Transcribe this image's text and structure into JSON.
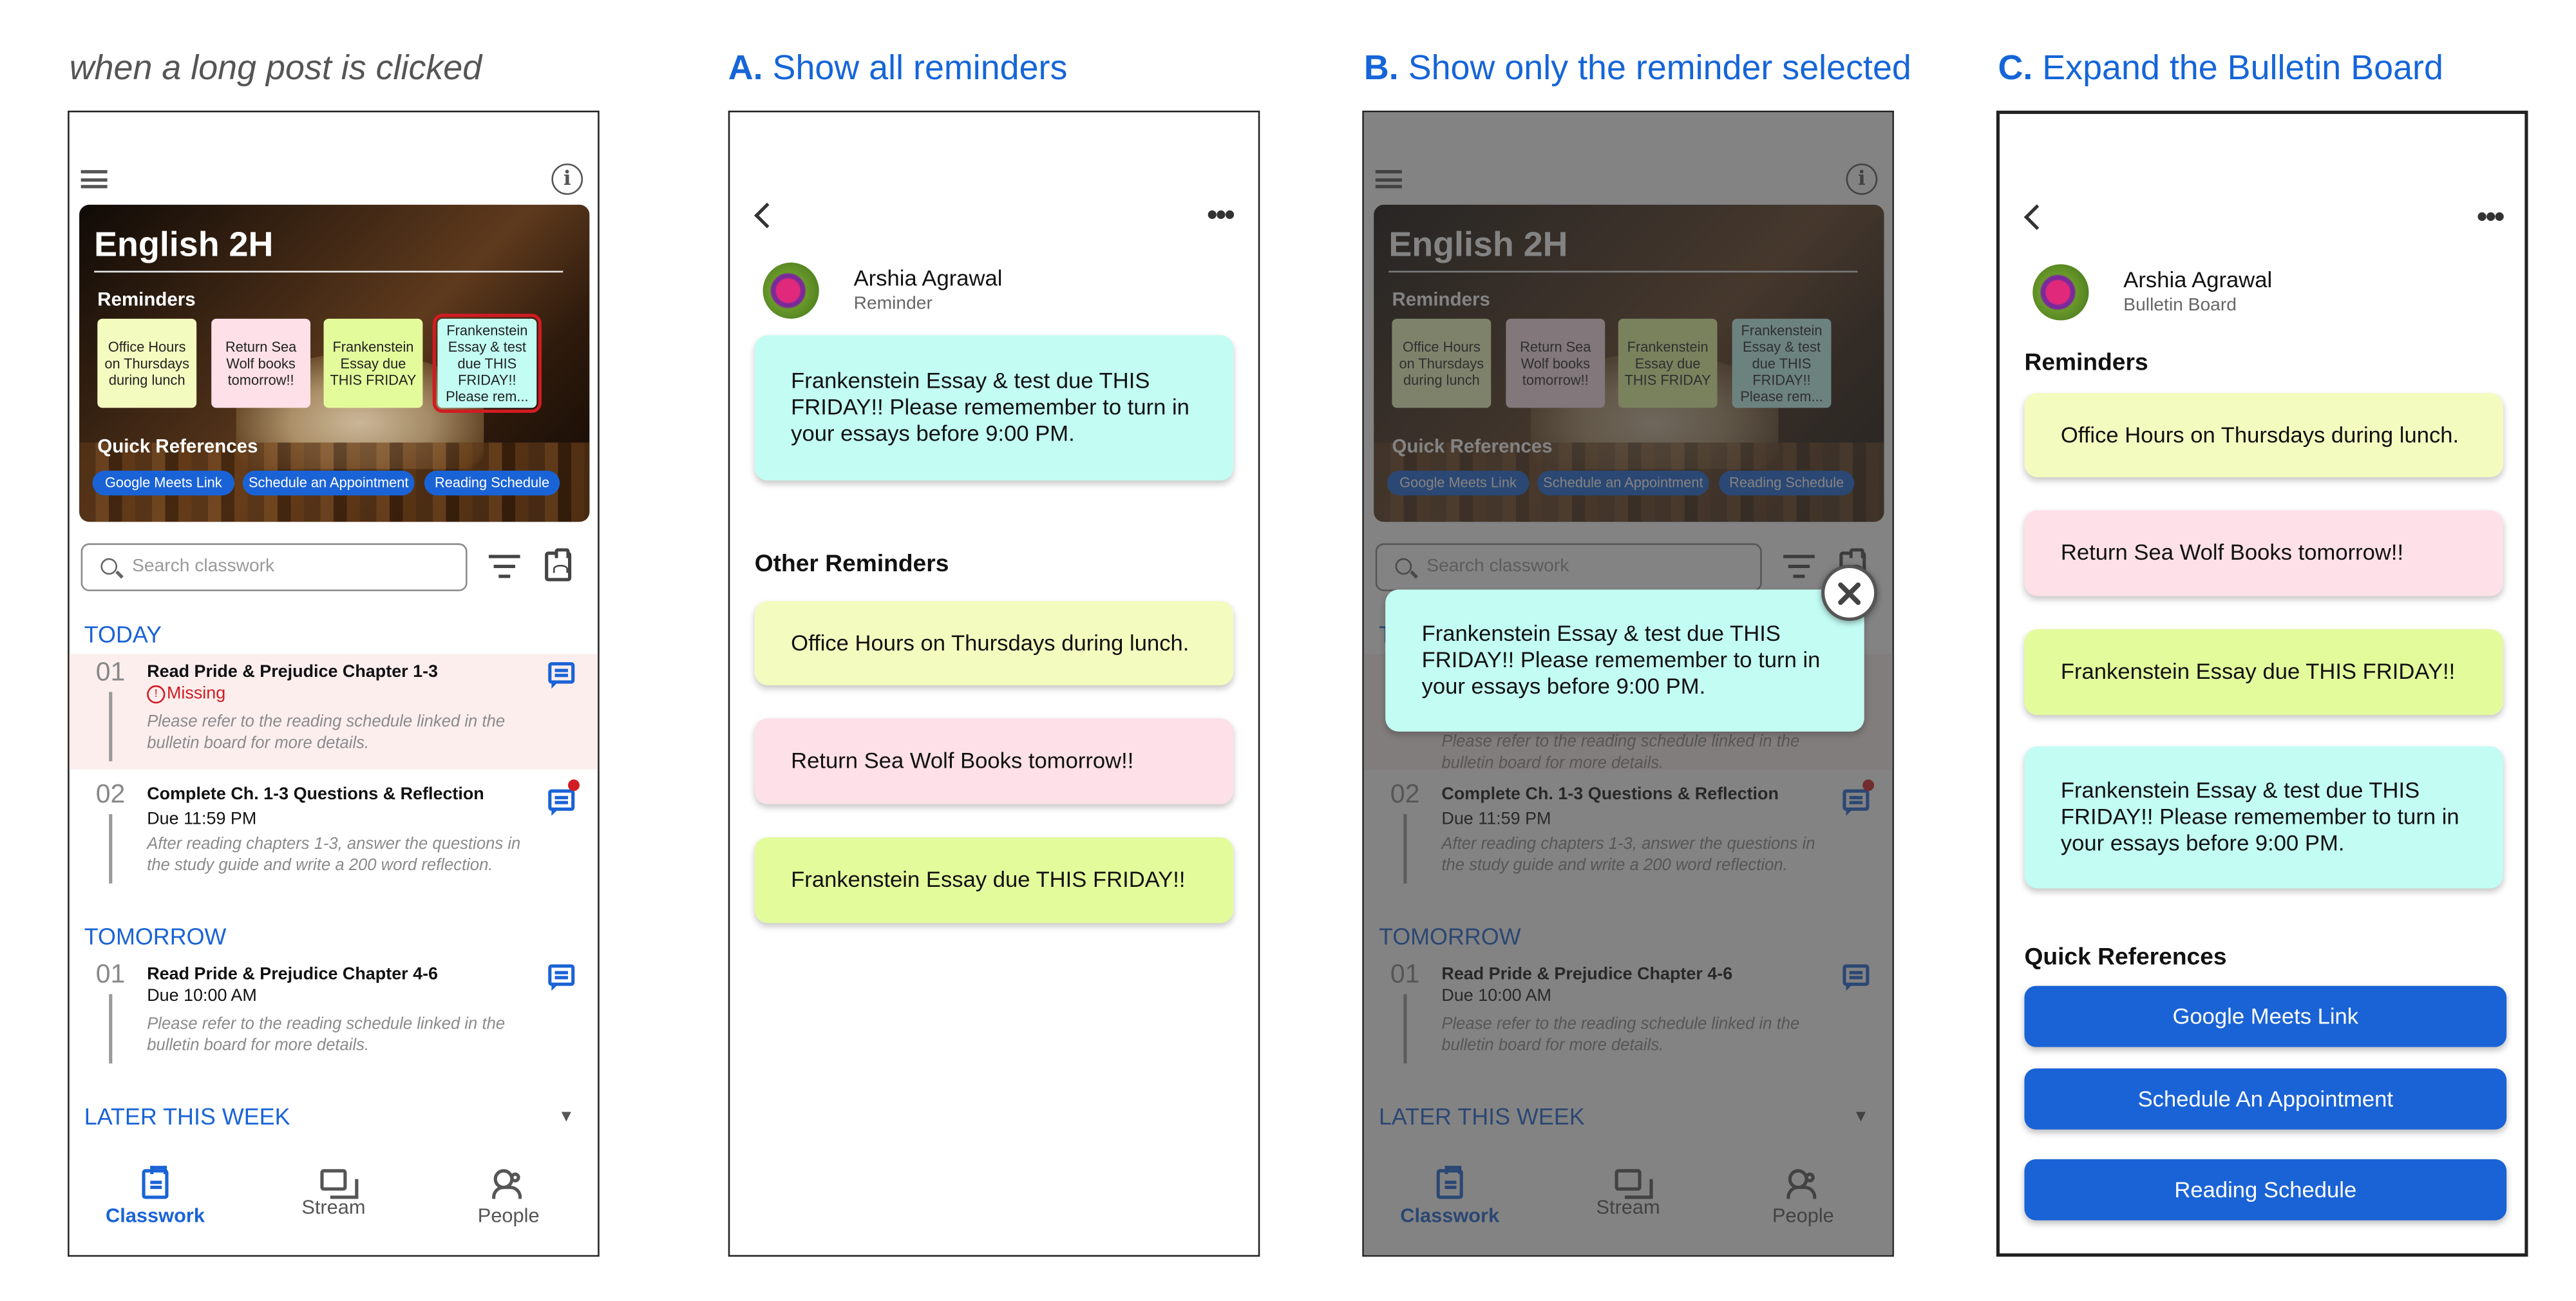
{
  "titles": {
    "p1": "when a long post is clicked",
    "p2_letter": "A.",
    "p2": "Show all reminders",
    "p3_letter": "B.",
    "p3": "Show only the reminder selected",
    "p4_letter": "C.",
    "p4": "Expand the Bulletin Board"
  },
  "colors": {
    "accent": "#1a63d6",
    "missing": "#d01c22",
    "yellow": "#f4fbbf",
    "pink": "#fde0e8",
    "green": "#e4fb9c",
    "cyan": "#c2fcf3"
  },
  "classroom": {
    "course_title": "English 2H",
    "reminders_label": "Reminders",
    "reminders": [
      "Office Hours on Thursdays during lunch",
      "Return Sea Wolf books tomorrow!!",
      "Frankenstein Essay due THIS FRIDAY",
      "Frankenstein Essay & test due THIS FRIDAY!! Please rem..."
    ],
    "quick_label": "Quick References",
    "quick": [
      "Google Meets Link",
      "Schedule an Appointment",
      "Reading Schedule"
    ],
    "search_placeholder": "Search classwork",
    "today": "TODAY",
    "tomorrow": "TOMORROW",
    "later": "LATER THIS WEEK",
    "a1": {
      "num": "01",
      "title": "Read Pride & Prejudice Chapter 1-3",
      "status": "Missing",
      "desc": "Please refer to the reading schedule linked in the bulletin board for more details."
    },
    "a2": {
      "num": "02",
      "title": "Complete Ch. 1-3 Questions & Reflection",
      "due": "Due 11:59 PM",
      "desc": "After reading chapters 1-3, answer the questions in the study guide and write a 200 word reflection."
    },
    "a3": {
      "num": "01",
      "title": "Read Pride & Prejudice Chapter 4-6",
      "due": "Due 10:00 AM",
      "desc": "Please refer to the reading schedule linked in the bulletin board for more details."
    },
    "nav": [
      "Classwork",
      "Stream",
      "People"
    ]
  },
  "reminder_view": {
    "user": "Arshia Agrawal",
    "role": "Reminder",
    "selected": "Frankenstein Essay & test due THIS FRIDAY!! Please rememember to turn in your essays before 9:00 PM.",
    "other_label": "Other Reminders",
    "others": [
      "Office Hours on Thursdays during lunch.",
      "Return Sea Wolf Books tomorrow!!",
      "Frankenstein Essay due THIS FRIDAY!!"
    ]
  },
  "popup": {
    "text": "Frankenstein Essay & test due THIS FRIDAY!! Please rememember to turn in your essays before 9:00 PM."
  },
  "bulletin": {
    "user": "Arshia Agrawal",
    "role": "Bulletin Board",
    "reminders_label": "Reminders",
    "reminders": [
      "Office Hours on Thursdays during lunch.",
      "Return Sea Wolf Books tomorrow!!",
      "Frankenstein Essay due THIS FRIDAY!!",
      "Frankenstein Essay & test due THIS FRIDAY!! Please rememember to turn in your essays before 9:00 PM."
    ],
    "quick_label": "Quick References",
    "buttons": [
      "Google Meets Link",
      "Schedule An Appointment",
      "Reading Schedule"
    ]
  }
}
